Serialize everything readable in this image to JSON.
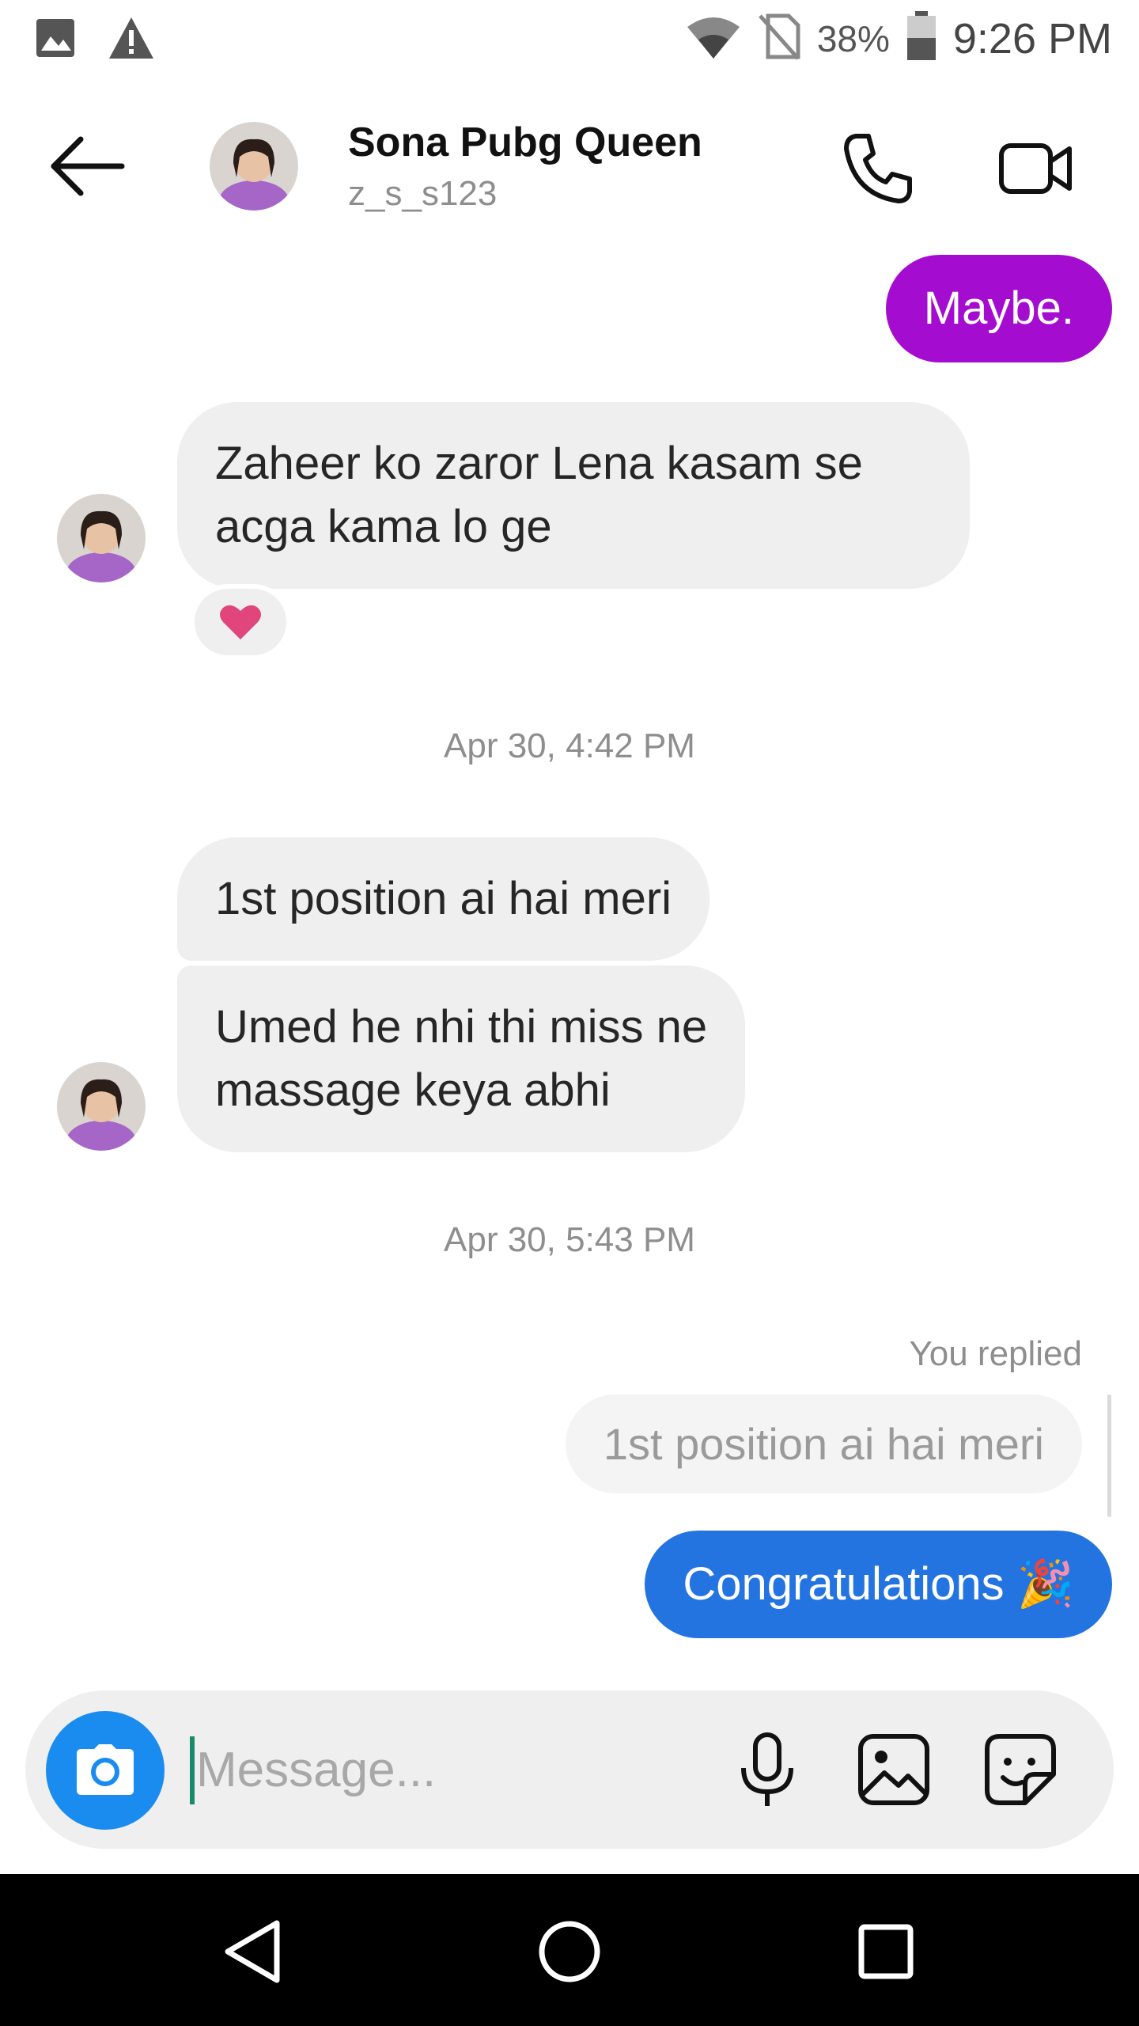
{
  "status_bar": {
    "battery": "38%",
    "time": "9:26 PM",
    "icons": [
      "gallery-icon",
      "warning-icon",
      "wifi-icon",
      "no-sim-icon",
      "battery-icon"
    ]
  },
  "header": {
    "name": "Sona Pubg Queen",
    "username": "z_s_s123",
    "icons": [
      "back-arrow-icon",
      "phone-icon",
      "video-icon"
    ]
  },
  "messages": {
    "sent_maybe": "Maybe.",
    "recv_1_line1": "Zaheer ko zaror Lena kasam se",
    "recv_1_line2": "acga kama lo ge",
    "reaction": "heart",
    "timestamp_1": "Apr 30, 4:42 PM",
    "recv_2": "1st position ai hai meri",
    "recv_3_line1": "Umed he nhi thi miss ne",
    "recv_3_line2": "massage keya abhi",
    "timestamp_2": "Apr 30, 5:43 PM",
    "you_replied": "You replied",
    "reply_quote": "1st position ai hai meri",
    "sent_congrats": "Congratulations",
    "sent_congrats_emoji": "🎉"
  },
  "composer": {
    "placeholder": "Message...",
    "icons": [
      "camera-icon",
      "microphone-icon",
      "gallery-icon",
      "sticker-icon"
    ]
  },
  "colors": {
    "purple_bubble": "#a40ccf",
    "blue_bubble": "#2374e1",
    "camera_button": "#1a8cf0",
    "heart": "#e0457b"
  },
  "nav_bar": {
    "icons": [
      "back-triangle-icon",
      "home-circle-icon",
      "recents-square-icon"
    ]
  }
}
